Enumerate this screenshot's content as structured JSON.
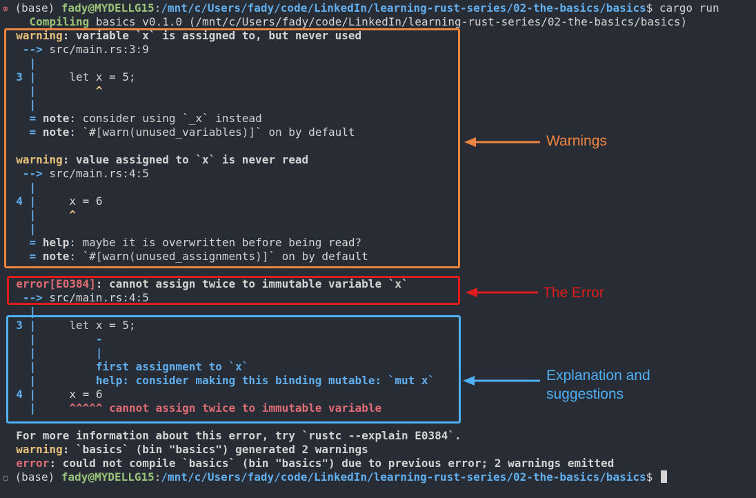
{
  "prompt": {
    "fail_icon": "⊗",
    "ok_icon": "○",
    "env": "(base)",
    "user_host": "fady@MYDELLG15",
    "path": "/mnt/c/Users/fady/code/LinkedIn/learning-rust-series/02-the-basics/basics",
    "symbol": "$",
    "command": " cargo run"
  },
  "compile": {
    "label": "Compiling",
    "rest": " basics v0.1.0 (/mnt/c/Users/fady/code/LinkedIn/learning-rust-series/02-the-basics/basics)"
  },
  "warning1": {
    "label": "warning",
    "message": ": variable `x` is assigned to, but never used",
    "arrow": " -->",
    "location": " src/main.rs:3:9",
    "line_no": "3",
    "code": "let x = 5;",
    "caret": "^",
    "note1_label": "note",
    "note1_text": ": consider using `_x` instead",
    "note2_label": "note",
    "note2_text": ": `#[warn(unused_variables)]` on by default"
  },
  "warning2": {
    "label": "warning",
    "message": ": value assigned to `x` is never read",
    "arrow": " -->",
    "location": " src/main.rs:4:5",
    "line_no": "4",
    "code": "x = 6",
    "caret": "^",
    "help_label": "help",
    "help_text": ": maybe it is overwritten before being read?",
    "note_label": "note",
    "note_text": ": `#[warn(unused_assignments)]` on by default"
  },
  "error": {
    "label": "error[E0384]",
    "message": ": cannot assign twice to immutable variable `x`",
    "arrow": " -->",
    "location": " src/main.rs:4:5",
    "line3_no": "3",
    "line3_code": "let x = 5;",
    "dash": "-",
    "bar": "|",
    "first_assignment": "first assignment to `x`",
    "help": "help: consider making this binding mutable: `mut x`",
    "line4_no": "4",
    "line4_code": "x = 6",
    "carets": "^^^^^",
    "caret_message": " cannot assign twice to immutable variable"
  },
  "footer": {
    "more_info": "For more information about this error, try `rustc --explain E0384`.",
    "summary_warning_label": "warning",
    "summary_warning_text": ": `basics` (bin \"basics\") generated 2 warnings",
    "summary_error_label": "error",
    "summary_error_text": ": could not compile `basics` (bin \"basics\") due to previous error; 2 warnings emitted"
  },
  "gutter": {
    "pipe": "|",
    "eq": "="
  },
  "annotations": {
    "warnings": "Warnings",
    "error": "The Error",
    "explanation_line1": "Explanation and",
    "explanation_line2": "suggestions"
  },
  "colors": {
    "background": "#282c34",
    "warning": "#e5c07b",
    "error": "#e06c75",
    "accent_blue": "#61afef",
    "green": "#98c379",
    "annotation_orange": "#f08441",
    "annotation_red": "#e01b1b",
    "annotation_blue": "#4fb0f5"
  }
}
